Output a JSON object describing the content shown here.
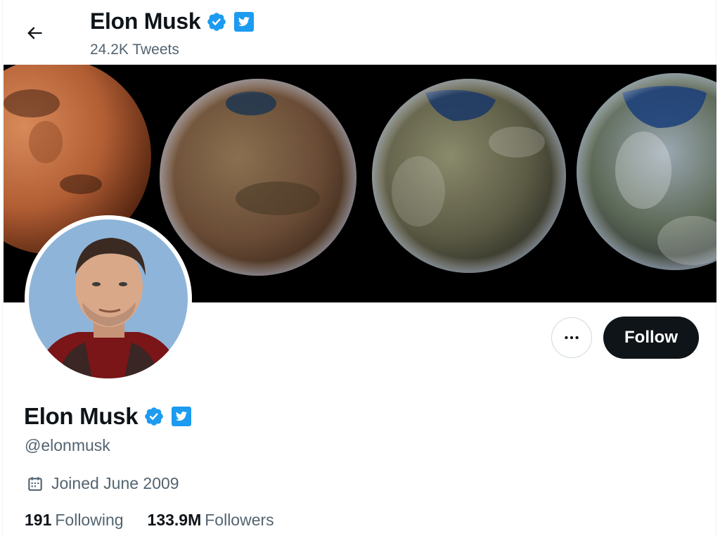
{
  "header": {
    "name": "Elon Musk",
    "tweet_count": "24.2K Tweets"
  },
  "profile": {
    "name": "Elon Musk",
    "handle": "@elonmusk",
    "joined": "Joined June 2009",
    "following_count": "191",
    "following_label": "Following",
    "followers_count": "133.9M",
    "followers_label": "Followers"
  },
  "actions": {
    "follow_label": "Follow"
  },
  "icons": {
    "back": "arrow-left-icon",
    "verified": "verified-badge-icon",
    "affiliate": "twitter-bird-badge-icon",
    "more": "more-horizontal-icon",
    "calendar": "calendar-icon"
  },
  "colors": {
    "accent": "#1d9bf0",
    "text_primary": "#0f1419",
    "text_secondary": "#536471",
    "follow_bg": "#0f1419"
  }
}
